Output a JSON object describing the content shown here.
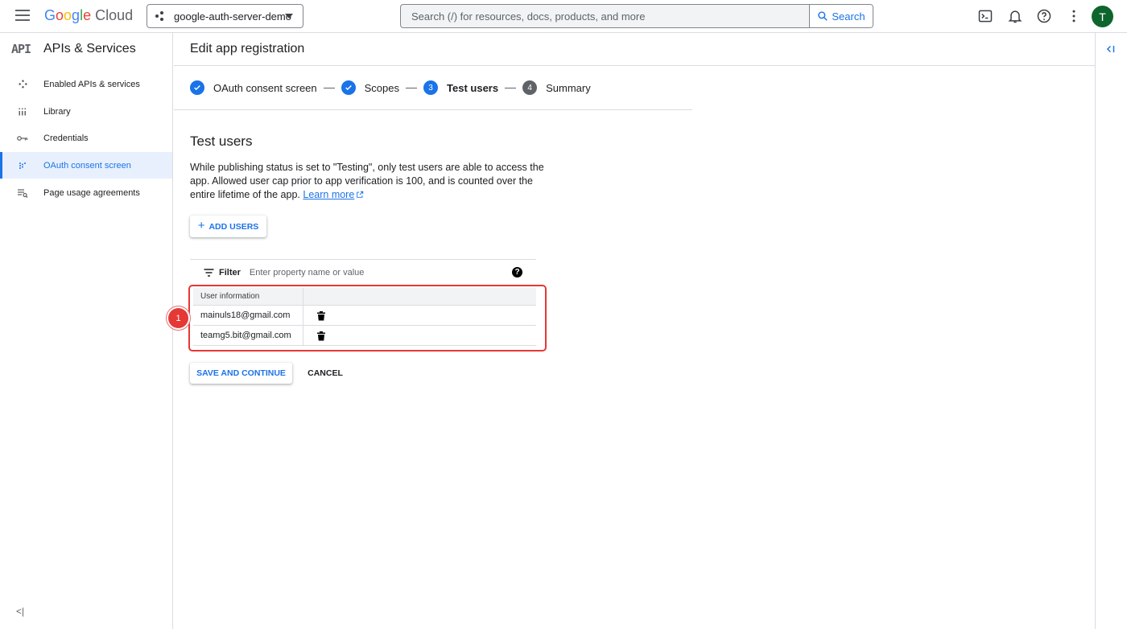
{
  "topbar": {
    "logo": {
      "g1": "G",
      "g2": "o",
      "g3": "o",
      "g4": "g",
      "g5": "l",
      "g6": "e",
      "cloud": " Cloud"
    },
    "project": "google-auth-server-demo",
    "search_placeholder": "Search (/) for resources, docs, products, and more",
    "search_button": "Search",
    "avatar_initial": "T",
    "icons": [
      "menu-icon",
      "terminal-icon",
      "bell-icon",
      "help-icon",
      "more-vert-icon"
    ]
  },
  "sidebar": {
    "badge": "API",
    "title": "APIs & Services",
    "items": [
      {
        "label": "Enabled APIs & services",
        "icon": "enabled-apis-icon"
      },
      {
        "label": "Library",
        "icon": "library-icon"
      },
      {
        "label": "Credentials",
        "icon": "key-icon"
      },
      {
        "label": "OAuth consent screen",
        "icon": "consent-icon",
        "active": true
      },
      {
        "label": "Page usage agreements",
        "icon": "agreements-icon"
      }
    ],
    "collapse": "<|"
  },
  "main": {
    "page_title": "Edit app registration",
    "steps": [
      {
        "label": "OAuth consent screen",
        "state": "done"
      },
      {
        "label": "Scopes",
        "state": "done"
      },
      {
        "label": "Test users",
        "state": "current",
        "number": "3"
      },
      {
        "label": "Summary",
        "state": "todo",
        "number": "4"
      }
    ],
    "section_title": "Test users",
    "description": "While publishing status is set to \"Testing\", only test users are able to access the app. Allowed user cap prior to app verification is 100, and is counted over the entire lifetime of the app.",
    "learn_more": "Learn more",
    "add_users": "ADD USERS",
    "filter_label": "Filter",
    "filter_placeholder": "Enter property name or value",
    "table": {
      "header": "User information",
      "rows": [
        "mainuls18@gmail.com",
        "teamg5.bit@gmail.com"
      ]
    },
    "annotation_number": "1",
    "save_button": "SAVE AND CONTINUE",
    "cancel_button": "CANCEL"
  },
  "colors": {
    "accent": "#1a73e8",
    "highlight": "#e53935",
    "avatar": "#0d652d"
  }
}
